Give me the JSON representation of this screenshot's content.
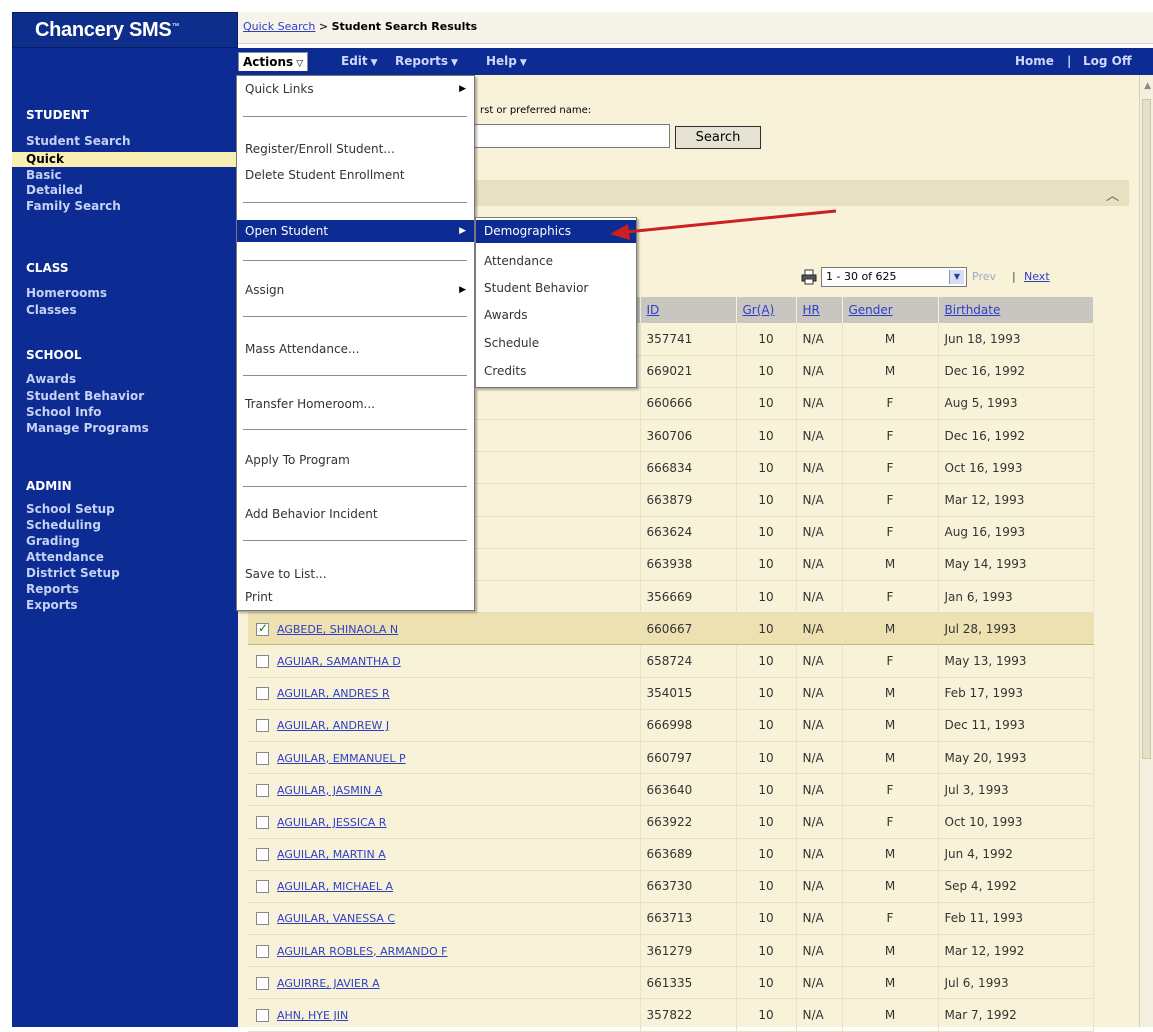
{
  "app": {
    "logo": "Chancery SMS",
    "logo_tm": "™"
  },
  "breadcrumb": {
    "link": "Quick Search",
    "separator": ">",
    "current": "Student Search Results"
  },
  "menubar": {
    "actions": "Actions",
    "edit": "Edit",
    "reports": "Reports",
    "help": "Help",
    "home": "Home",
    "separator": "|",
    "logoff": "Log Off"
  },
  "sidebar": {
    "sections": [
      {
        "title": "STUDENT",
        "items": [
          "Student Search",
          "Quick",
          "Basic",
          "Detailed",
          "Family Search"
        ]
      },
      {
        "title": "CLASS",
        "items": [
          "Homerooms",
          "Classes"
        ]
      },
      {
        "title": "SCHOOL",
        "items": [
          "Awards",
          "Student Behavior",
          "School Info",
          "Manage Programs"
        ]
      },
      {
        "title": "ADMIN",
        "items": [
          "School Setup",
          "Scheduling",
          "Grading",
          "Attendance",
          "District Setup",
          "Reports",
          "Exports"
        ]
      }
    ],
    "selected_item": "Quick"
  },
  "search": {
    "prompt": "rst or preferred name:",
    "input_value": "",
    "button": "Search"
  },
  "pager": {
    "range": "1 - 30 of 625",
    "prev": "Prev",
    "separator": "|",
    "next": "Next"
  },
  "table": {
    "columns": [
      "ID",
      "Gr(A)",
      "HR",
      "Gender",
      "Birthdate"
    ],
    "rows": [
      {
        "name": "",
        "id": "357741",
        "gr": "10",
        "hr": "N/A",
        "gender": "M",
        "birthdate": "Jun 18, 1993",
        "checked": false
      },
      {
        "name": "",
        "id": "669021",
        "gr": "10",
        "hr": "N/A",
        "gender": "M",
        "birthdate": "Dec 16, 1992",
        "checked": false
      },
      {
        "name": "",
        "id": "660666",
        "gr": "10",
        "hr": "N/A",
        "gender": "F",
        "birthdate": "Aug 5, 1993",
        "checked": false
      },
      {
        "name": "",
        "id": "360706",
        "gr": "10",
        "hr": "N/A",
        "gender": "F",
        "birthdate": "Dec 16, 1992",
        "checked": false
      },
      {
        "name": "",
        "id": "666834",
        "gr": "10",
        "hr": "N/A",
        "gender": "F",
        "birthdate": "Oct 16, 1993",
        "checked": false
      },
      {
        "name": "",
        "id": "663879",
        "gr": "10",
        "hr": "N/A",
        "gender": "F",
        "birthdate": "Mar 12, 1993",
        "checked": false
      },
      {
        "name": "",
        "id": "663624",
        "gr": "10",
        "hr": "N/A",
        "gender": "F",
        "birthdate": "Aug 16, 1993",
        "checked": false
      },
      {
        "name": "",
        "id": "663938",
        "gr": "10",
        "hr": "N/A",
        "gender": "M",
        "birthdate": "May 14, 1993",
        "checked": false
      },
      {
        "name": "",
        "id": "356669",
        "gr": "10",
        "hr": "N/A",
        "gender": "F",
        "birthdate": "Jan 6, 1993",
        "checked": false
      },
      {
        "name": "AGBEDE, SHINAOLA N",
        "id": "660667",
        "gr": "10",
        "hr": "N/A",
        "gender": "M",
        "birthdate": "Jul 28, 1993",
        "checked": true
      },
      {
        "name": "AGUIAR, SAMANTHA D",
        "id": "658724",
        "gr": "10",
        "hr": "N/A",
        "gender": "F",
        "birthdate": "May 13, 1993",
        "checked": false
      },
      {
        "name": "AGUILAR, ANDRES R",
        "id": "354015",
        "gr": "10",
        "hr": "N/A",
        "gender": "M",
        "birthdate": "Feb 17, 1993",
        "checked": false
      },
      {
        "name": "AGUILAR, ANDREW J",
        "id": "666998",
        "gr": "10",
        "hr": "N/A",
        "gender": "M",
        "birthdate": "Dec 11, 1993",
        "checked": false
      },
      {
        "name": "AGUILAR, EMMANUEL P",
        "id": "660797",
        "gr": "10",
        "hr": "N/A",
        "gender": "M",
        "birthdate": "May 20, 1993",
        "checked": false
      },
      {
        "name": "AGUILAR, JASMIN A",
        "id": "663640",
        "gr": "10",
        "hr": "N/A",
        "gender": "F",
        "birthdate": "Jul 3, 1993",
        "checked": false
      },
      {
        "name": "AGUILAR, JESSICA R",
        "id": "663922",
        "gr": "10",
        "hr": "N/A",
        "gender": "F",
        "birthdate": "Oct 10, 1993",
        "checked": false
      },
      {
        "name": "AGUILAR, MARTIN A",
        "id": "663689",
        "gr": "10",
        "hr": "N/A",
        "gender": "M",
        "birthdate": "Jun 4, 1992",
        "checked": false
      },
      {
        "name": "AGUILAR, MICHAEL A",
        "id": "663730",
        "gr": "10",
        "hr": "N/A",
        "gender": "M",
        "birthdate": "Sep 4, 1992",
        "checked": false
      },
      {
        "name": "AGUILAR, VANESSA C",
        "id": "663713",
        "gr": "10",
        "hr": "N/A",
        "gender": "F",
        "birthdate": "Feb 11, 1993",
        "checked": false
      },
      {
        "name": "AGUILAR ROBLES, ARMANDO F",
        "id": "361279",
        "gr": "10",
        "hr": "N/A",
        "gender": "M",
        "birthdate": "Mar 12, 1992",
        "checked": false
      },
      {
        "name": "AGUIRRE, JAVIER A",
        "id": "661335",
        "gr": "10",
        "hr": "N/A",
        "gender": "M",
        "birthdate": "Jul 6, 1993",
        "checked": false
      },
      {
        "name": "AHN, HYE JIN",
        "id": "357822",
        "gr": "10",
        "hr": "N/A",
        "gender": "M",
        "birthdate": "Mar 7, 1992",
        "checked": false
      }
    ]
  },
  "actions_menu": {
    "items": [
      {
        "label": "Quick Links",
        "submenu": true
      },
      {
        "label": "Register/Enroll Student...",
        "submenu": false
      },
      {
        "label": "Delete Student Enrollment",
        "submenu": false
      },
      {
        "label": "Open Student",
        "submenu": true,
        "active": true
      },
      {
        "label": "Assign",
        "submenu": true
      },
      {
        "label": "Mass Attendance...",
        "submenu": false
      },
      {
        "label": "Transfer Homeroom...",
        "submenu": false
      },
      {
        "label": "Apply To Program",
        "submenu": false
      },
      {
        "label": "Add Behavior Incident",
        "submenu": false
      },
      {
        "label": "Save to List...",
        "submenu": false
      },
      {
        "label": "Print",
        "submenu": false
      }
    ]
  },
  "open_student_submenu": {
    "items": [
      "Demographics",
      "Attendance",
      "Student Behavior",
      "Awards",
      "Schedule",
      "Credits"
    ],
    "active": "Demographics"
  },
  "colors": {
    "nav_blue": "#0c2c93",
    "content_bg": "#f8f2d8",
    "selected_nav": "#f9efb4",
    "arrow_red": "#cc1f1f"
  }
}
